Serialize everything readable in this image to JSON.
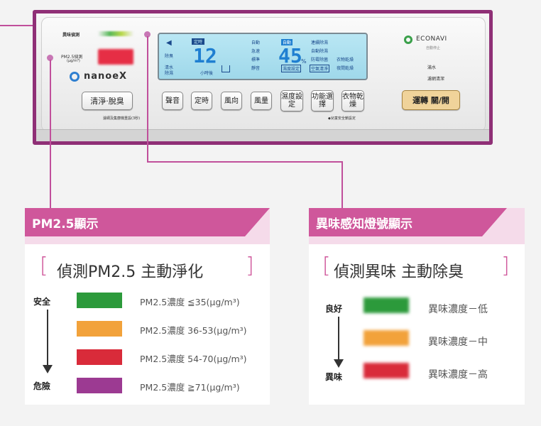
{
  "device": {
    "odor_sensor_label": "異味偵測",
    "pm25_sensor_label": "PM2.5偵測",
    "pm25_unit": "(μg/m³)",
    "brand": "nanoeX",
    "clean_button": "清淨‧脫臭",
    "clean_button_note": "濾網及集塵機重設(3秒)",
    "lcd": {
      "timer_label": "定時",
      "pm_value": "12",
      "hours_label": "小時後",
      "humidity_value": "45",
      "percent": "%",
      "left_labels": [
        "除臭",
        "清水",
        "除濕"
      ],
      "mode_labels": [
        "自動",
        "急速",
        "標準",
        "靜音"
      ],
      "fan_labels": [
        "連續除濕",
        "自動除濕",
        "防霉除菌",
        "衣物乾燥",
        "濕度設定",
        "空氣清淨",
        "夜間乾燥"
      ],
      "top_mode": "自動"
    },
    "buttons": [
      "聲音",
      "定時",
      "風向",
      "風量",
      "濕度設定",
      "功能選擇",
      "衣物乾燥"
    ],
    "buttons_note": "◆兒童安全鎖設定",
    "econavi": "ECONAVI",
    "econavi_sub": "自動停止",
    "indicator_full": "滿水",
    "indicator_clean": "濾網清潔",
    "power_button": "運轉 關/開"
  },
  "pm25_legend": {
    "title": "PM2.5顯示",
    "tagline": "偵測PM2.5 主動淨化",
    "bracket_left": "[",
    "bracket_right": "]",
    "top_label": "安全",
    "bottom_label": "危險",
    "levels": [
      {
        "color": "#2c9a3b",
        "text": "PM2.5濃度 ≦35(μg/m³)"
      },
      {
        "color": "#f2a23b",
        "text": "PM2.5濃度 36-53(μg/m³)"
      },
      {
        "color": "#d92b3a",
        "text": "PM2.5濃度 54-70(μg/m³)"
      },
      {
        "color": "#9c3a92",
        "text": "PM2.5濃度 ≧71(μg/m³)"
      }
    ]
  },
  "odor_legend": {
    "title": "異味感知燈號顯示",
    "tagline": "偵測異味 主動除臭",
    "bracket_left": "[",
    "bracket_right": "]",
    "top_label": "良好",
    "bottom_label": "異味",
    "levels": [
      {
        "color": "#2c9a3b",
        "text": "異味濃度－低"
      },
      {
        "color": "#f2a23b",
        "text": "異味濃度－中"
      },
      {
        "color": "#d92b3a",
        "text": "異味濃度－高"
      }
    ]
  }
}
